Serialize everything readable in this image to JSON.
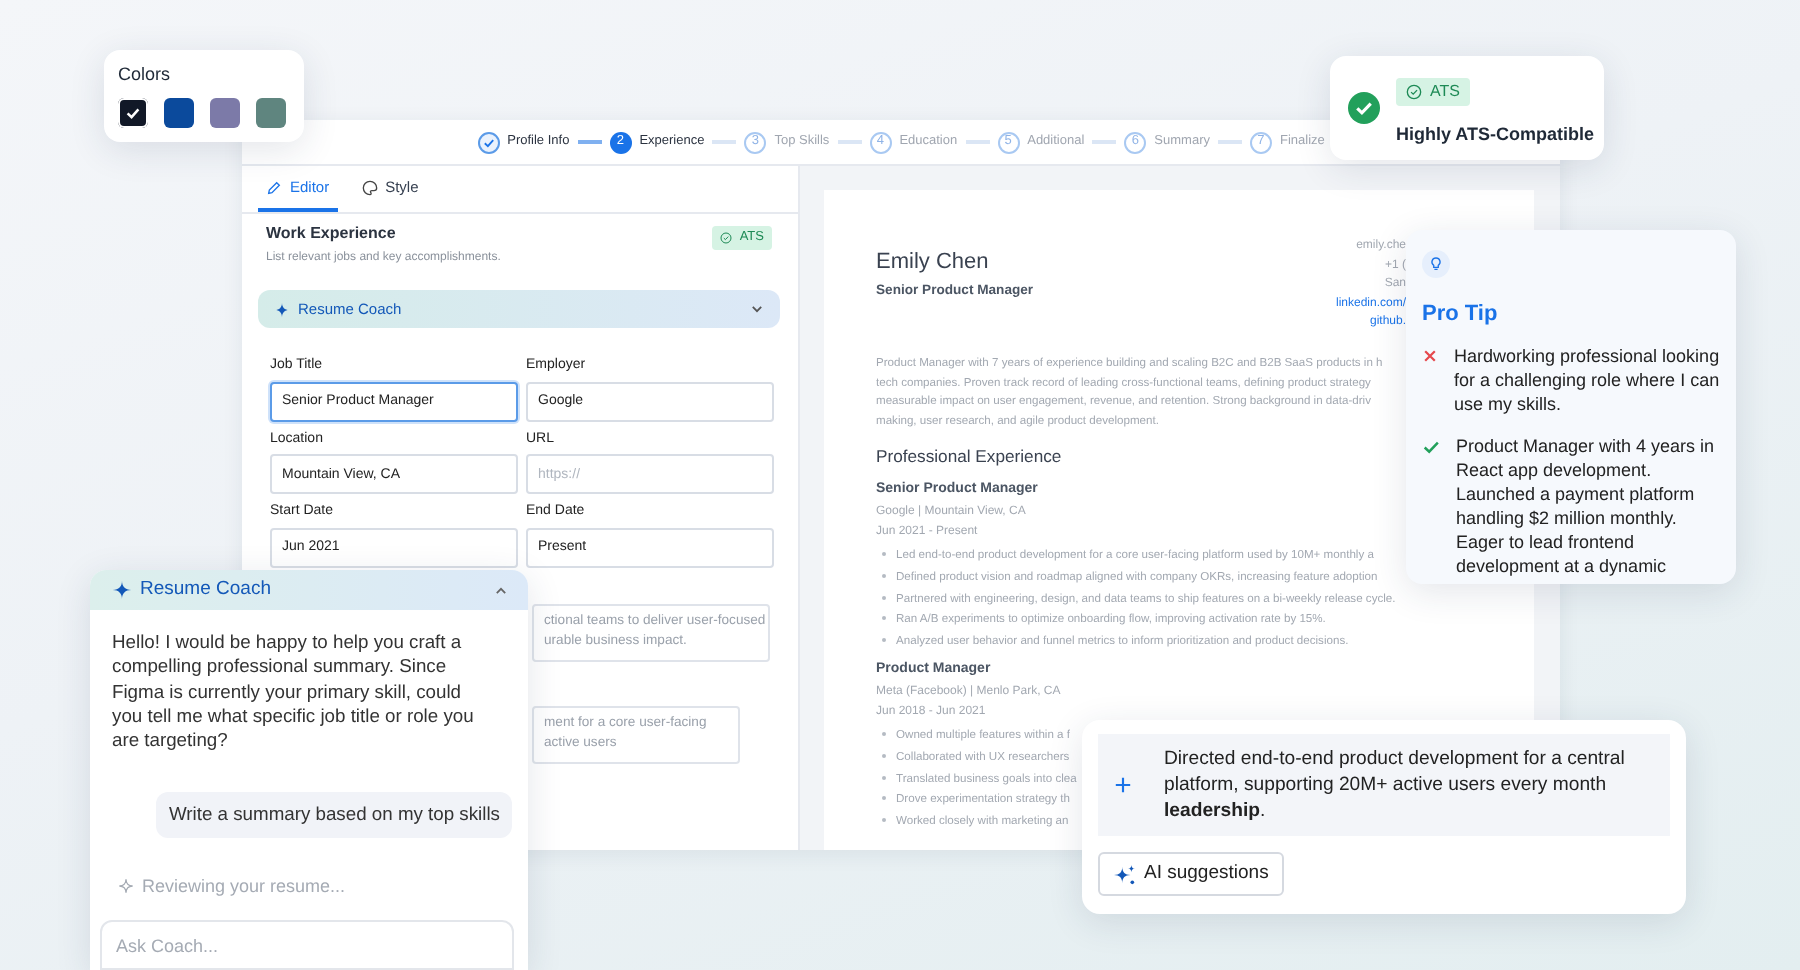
{
  "colors_card": {
    "title": "Colors",
    "swatches": [
      {
        "color": "#111827",
        "selected": true
      },
      {
        "color": "#0b4a9c",
        "selected": false
      },
      {
        "color": "#7c7aa8",
        "selected": false
      },
      {
        "color": "#5f857f",
        "selected": false
      }
    ]
  },
  "ats_card": {
    "badge": "ATS",
    "title": "Highly ATS-Compatible"
  },
  "stepper": [
    {
      "label": "Profile Info",
      "completed": true,
      "selected": false
    },
    {
      "number": "2",
      "label": "Experience",
      "completed": false,
      "selected": true
    },
    {
      "number": "3",
      "label": "Top Skills",
      "completed": false,
      "selected": false
    },
    {
      "number": "4",
      "label": "Education",
      "completed": false,
      "selected": false
    },
    {
      "number": "5",
      "label": "Additional",
      "completed": false,
      "selected": false
    },
    {
      "number": "6",
      "label": "Summary",
      "completed": false,
      "selected": false
    },
    {
      "number": "7",
      "label": "Finalize",
      "completed": false,
      "selected": false
    }
  ],
  "editor": {
    "tabs": [
      {
        "label": "Editor",
        "selected": true
      },
      {
        "label": "Style",
        "selected": false
      }
    ],
    "section_title": "Work Experience",
    "section_subtitle": "List relevant jobs and key accomplishments.",
    "ats_badge": "ATS",
    "coach_bar": {
      "label": "Resume Coach",
      "expanded": false
    },
    "fields": [
      {
        "label": "Job Title",
        "value": "Senior Product Manager",
        "focused": true
      },
      {
        "label": "Employer",
        "value": "Google",
        "focused": false
      },
      {
        "label": "Location",
        "value": "Mountain View, CA",
        "focused": false
      },
      {
        "label": "URL",
        "placeholder": "https://",
        "focused": false
      },
      {
        "label": "Start Date",
        "value": "Jun 2021",
        "focused": false
      },
      {
        "label": "End Date",
        "value": "Present",
        "focused": false
      }
    ],
    "description_fragment": [
      "ctional teams to deliver user-focused",
      "urable business impact."
    ],
    "bullet_fragment": [
      "ment for a core user-facing",
      "active users"
    ]
  },
  "resume": {
    "name": "Emily Chen",
    "title": "Senior Product Manager",
    "contacts": [
      {
        "text": "emily.che",
        "kind": "text"
      },
      {
        "text": "+1 (",
        "kind": "text"
      },
      {
        "text": "San",
        "kind": "text"
      },
      {
        "text": "linkedin.com/",
        "kind": "link"
      },
      {
        "text": "github.",
        "kind": "link"
      }
    ],
    "summary_lines": [
      "Product Manager with 7 years of experience building and scaling B2C and B2B SaaS products in h",
      "tech companies. Proven track record of leading cross-functional teams, defining product strategy",
      "measurable impact on user engagement, revenue, and retention. Strong background in data-driv",
      "making, user research, and agile product development."
    ],
    "section_title": "Professional Experience",
    "jobs": [
      {
        "title": "Senior Product Manager",
        "meta": "Google | Mountain View, CA",
        "dates": "Jun 2021 - Present",
        "bullets": [
          "Led end-to-end product development for a core user-facing platform used by 10M+ monthly a",
          "Defined product vision and roadmap aligned with company OKRs, increasing feature adoption",
          "Partnered with engineering, design, and data teams to ship features on a bi-weekly release cycle.",
          "Ran A/B experiments to optimize onboarding flow, improving activation rate by 15%.",
          "Analyzed user behavior and funnel metrics to inform prioritization and product decisions."
        ]
      },
      {
        "title": "Product Manager",
        "meta": "Meta (Facebook) | Menlo Park, CA",
        "dates": "Jun 2018 - Jun 2021",
        "bullets": [
          "Owned multiple features within a f",
          "Collaborated with UX researchers",
          "Translated business goals into clea",
          "Drove experimentation strategy th",
          "Worked closely with marketing an"
        ]
      }
    ]
  },
  "pro_tip": {
    "title": "Pro Tip",
    "examples": [
      {
        "kind": "bad",
        "text": "Hardworking professional looking for a challenging role where I can use my skills."
      },
      {
        "kind": "good",
        "text": "Product Manager with 4 years in React app development. Launched a payment platform handling $2 million monthly. Eager to lead frontend development at a dynamic"
      }
    ]
  },
  "coach_panel": {
    "title": "Resume Coach",
    "expanded": true,
    "messages": [
      {
        "kind": "assistant",
        "text": "Hello! I would be happy to help you craft a compelling professional summary. Since Figma is currently your primary skill, could you tell me what specific job title or role you are targeting?"
      },
      {
        "kind": "user",
        "text": "Write a summary based on my top skills"
      }
    ],
    "status": "Reviewing your resume...",
    "input_placeholder": "Ask Coach..."
  },
  "ai_card": {
    "suggestion": "Directed end-to-end product development for a central platform, supporting 20M+ active users every month **leadership**.",
    "button": "AI suggestions"
  }
}
